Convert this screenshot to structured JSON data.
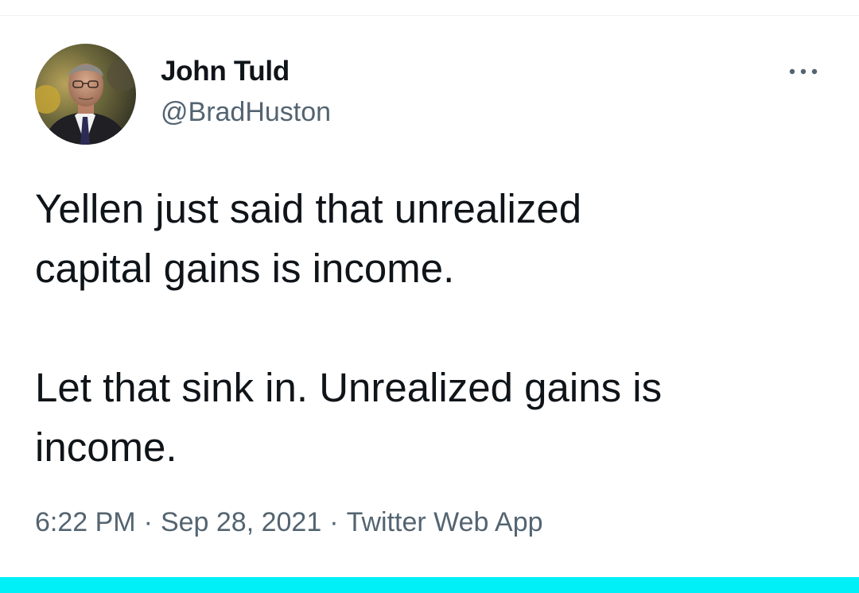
{
  "tweet": {
    "author": {
      "display_name": "John Tuld",
      "handle": "@BradHuston",
      "avatar_icon": "profile-photo"
    },
    "more_icon": "more-horizontal-icon",
    "text_lines": [
      "Yellen just said that unrealized",
      "capital gains is income.",
      "Let that sink in.  Unrealized gains is",
      "income."
    ],
    "meta": {
      "time": "6:22 PM",
      "separator": "·",
      "date": "Sep 28, 2021",
      "source": "Twitter Web App"
    }
  },
  "colors": {
    "text_primary": "#0f1419",
    "text_secondary": "#536471",
    "bottom_bar": "#00f0f8",
    "divider": "#eff3f4"
  }
}
